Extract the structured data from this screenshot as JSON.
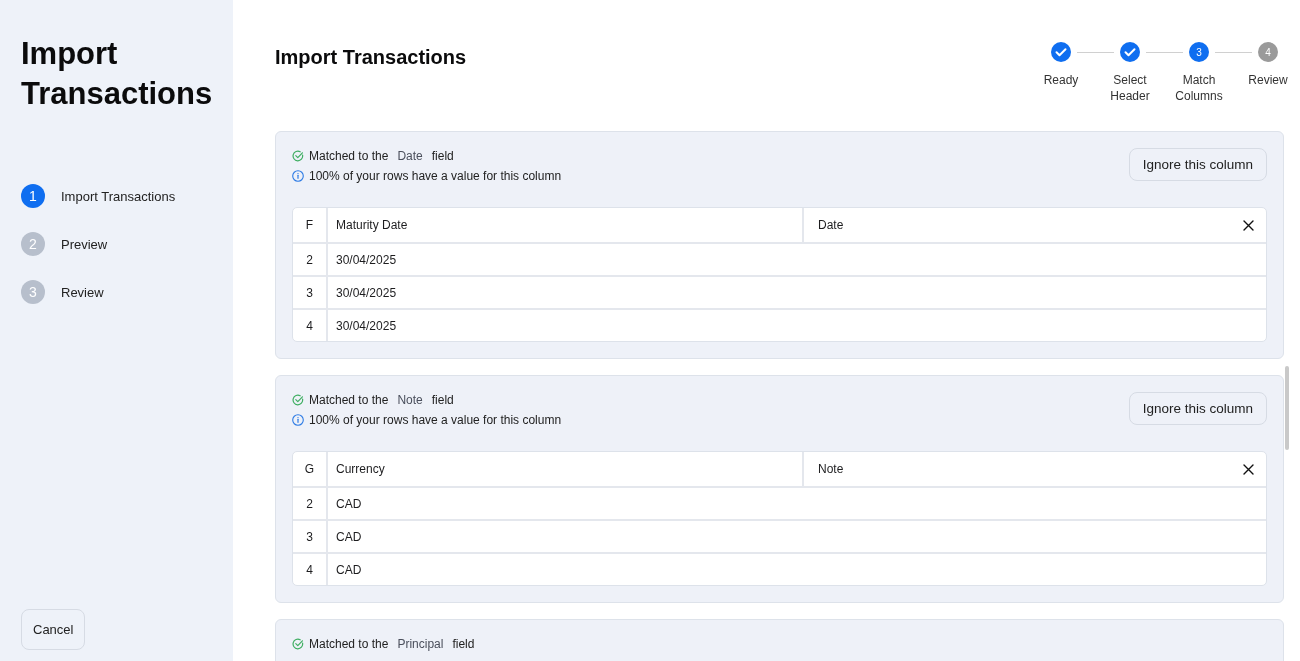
{
  "sidebar": {
    "title": "Import Transactions",
    "steps": [
      {
        "number": "1",
        "label": "Import Transactions",
        "selected": true
      },
      {
        "number": "2",
        "label": "Preview",
        "selected": false
      },
      {
        "number": "3",
        "label": "Review",
        "selected": false
      }
    ],
    "cancel_button": "Cancel"
  },
  "main": {
    "title": "Import Transactions",
    "stepper": [
      {
        "label": "Ready",
        "completed": true
      },
      {
        "label": "Select Header",
        "completed": true
      },
      {
        "number": "3",
        "label": "Match Columns",
        "completed": false,
        "active": true
      },
      {
        "number": "4",
        "label": "Review",
        "completed": false,
        "active": false
      }
    ],
    "columns": [
      {
        "matched_prefix": "Matched to the",
        "field": "Date",
        "matched_suffix": "field",
        "coverage": "100% of your rows have a value for this column",
        "ignore_button": "Ignore this column",
        "column_letter": "F",
        "source_header": "Maturity Date",
        "mapped_field": "Date",
        "rows": [
          {
            "number": "2",
            "value": "30/04/2025"
          },
          {
            "number": "3",
            "value": "30/04/2025"
          },
          {
            "number": "4",
            "value": "30/04/2025"
          }
        ]
      },
      {
        "matched_prefix": "Matched to the",
        "field": "Note",
        "matched_suffix": "field",
        "coverage": "100% of your rows have a value for this column",
        "ignore_button": "Ignore this column",
        "column_letter": "G",
        "source_header": "Currency",
        "mapped_field": "Note",
        "rows": [
          {
            "number": "2",
            "value": "CAD"
          },
          {
            "number": "3",
            "value": "CAD"
          },
          {
            "number": "4",
            "value": "CAD"
          }
        ]
      },
      {
        "matched_prefix": "Matched to the",
        "field": "Principal",
        "matched_suffix": "field"
      }
    ]
  }
}
